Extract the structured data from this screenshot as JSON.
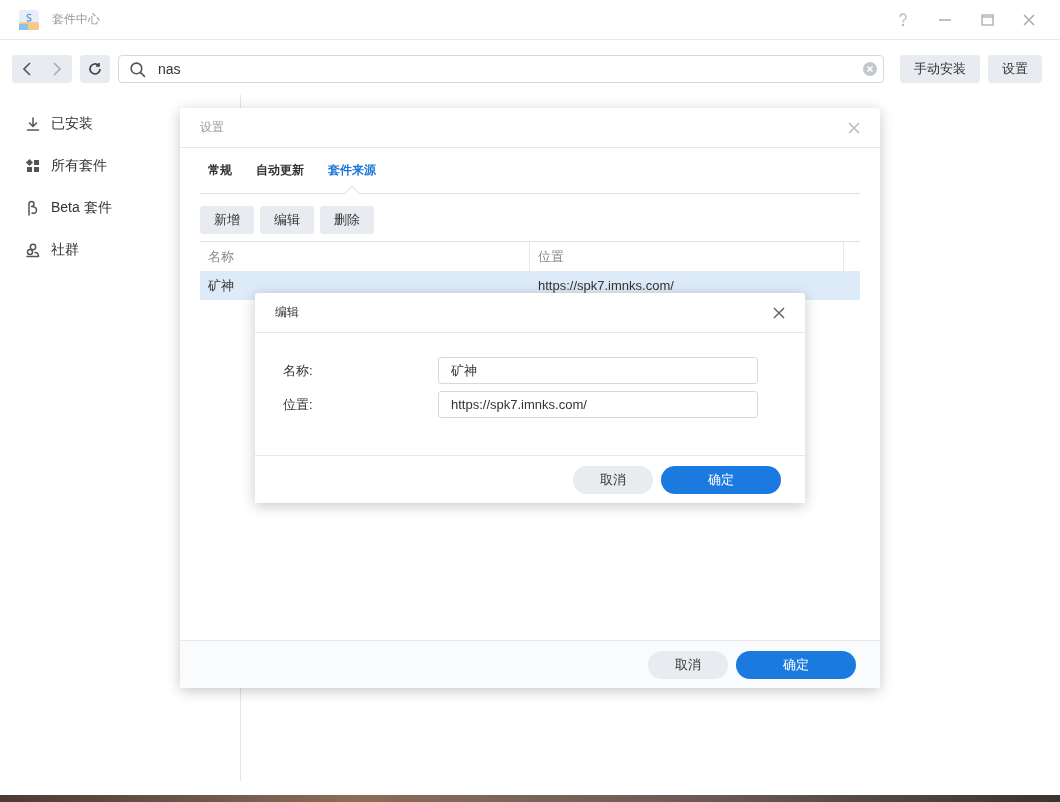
{
  "window": {
    "title": "套件中心"
  },
  "toolbar": {
    "search": {
      "value": "nas"
    },
    "buttons": [
      "手动安装",
      "设置"
    ]
  },
  "sidebar": {
    "items": [
      {
        "label": "已安装",
        "kind": "installed"
      },
      {
        "label": "所有套件",
        "kind": "all"
      },
      {
        "label": "Beta 套件",
        "kind": "beta"
      },
      {
        "label": "社群",
        "kind": "community"
      }
    ]
  },
  "settings_dialog": {
    "title": "设置",
    "tabs": [
      {
        "label": "常规",
        "selected": false
      },
      {
        "label": "自动更新",
        "selected": false
      },
      {
        "label": "套件来源",
        "selected": true
      }
    ],
    "actions": [
      "新增",
      "编辑",
      "删除"
    ],
    "table": {
      "columns": [
        "名称",
        "位置"
      ],
      "rows": [
        {
          "cells": [
            "矿神",
            "https://spk7.imnks.com/"
          ],
          "selected": true
        }
      ]
    },
    "buttons": [
      {
        "label": "取消",
        "kind": "secondary"
      },
      {
        "label": "确定",
        "kind": "primary"
      }
    ]
  },
  "edit_dialog": {
    "title": "编辑",
    "fields": [
      {
        "label": "名称:",
        "value": "矿神"
      },
      {
        "label": "位置:",
        "value": "https://spk7.imnks.com/"
      }
    ],
    "buttons": [
      {
        "label": "取消",
        "kind": "secondary"
      },
      {
        "label": "确定",
        "kind": "primary"
      }
    ]
  }
}
